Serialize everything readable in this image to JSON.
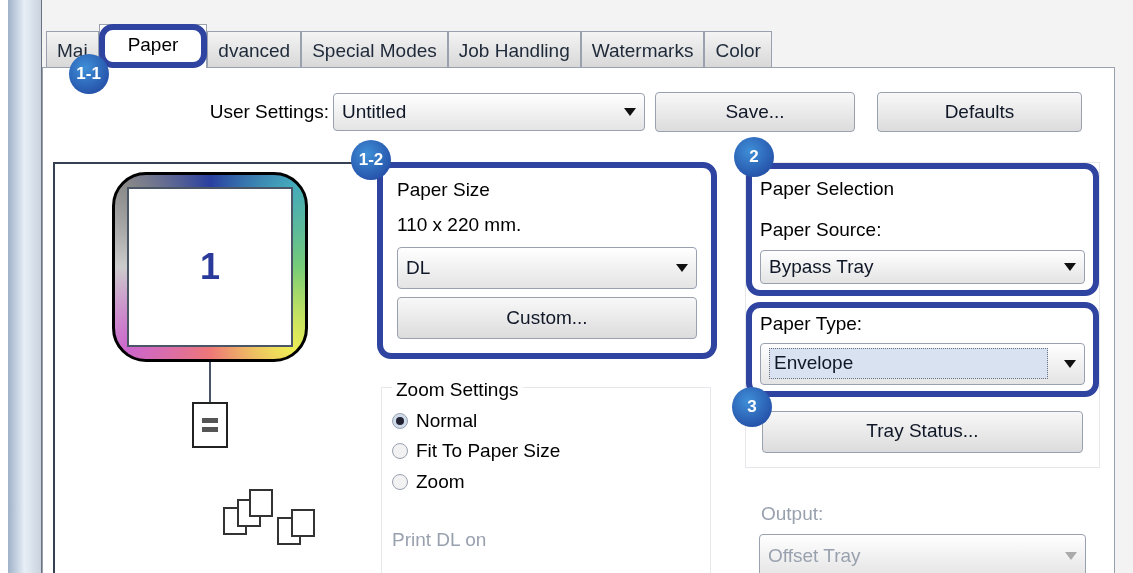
{
  "tabs": [
    {
      "label": "Mai",
      "selected": false
    },
    {
      "label": "Paper",
      "selected": true,
      "callout": "1-1"
    },
    {
      "label": "dvanced",
      "selected": false
    },
    {
      "label": "Special Modes",
      "selected": false
    },
    {
      "label": "Job Handling",
      "selected": false
    },
    {
      "label": "Watermarks",
      "selected": false
    },
    {
      "label": "Color",
      "selected": false
    }
  ],
  "user_settings": {
    "label": "User Settings:",
    "value": "Untitled",
    "save_button": "Save...",
    "defaults_button": "Defaults"
  },
  "preview": {
    "page_number": "1"
  },
  "paper_size": {
    "callout": "1-2",
    "title": "Paper Size",
    "dimensions": "110 x 220 mm.",
    "value": "DL",
    "custom_button": "Custom..."
  },
  "zoom_settings": {
    "title": "Zoom Settings",
    "options": [
      {
        "label": "Normal",
        "selected": true
      },
      {
        "label": "Fit To Paper Size",
        "selected": false
      },
      {
        "label": "Zoom",
        "selected": false
      }
    ],
    "print_label": "Print DL on"
  },
  "paper_selection": {
    "callout": "2",
    "title": "Paper Selection",
    "source_label": "Paper Source:",
    "source_value": "Bypass Tray"
  },
  "paper_type": {
    "callout": "3",
    "label": "Paper Type:",
    "value": "Envelope",
    "tray_status_button": "Tray Status..."
  },
  "output": {
    "label": "Output:",
    "value": "Offset Tray",
    "disabled": true
  }
}
